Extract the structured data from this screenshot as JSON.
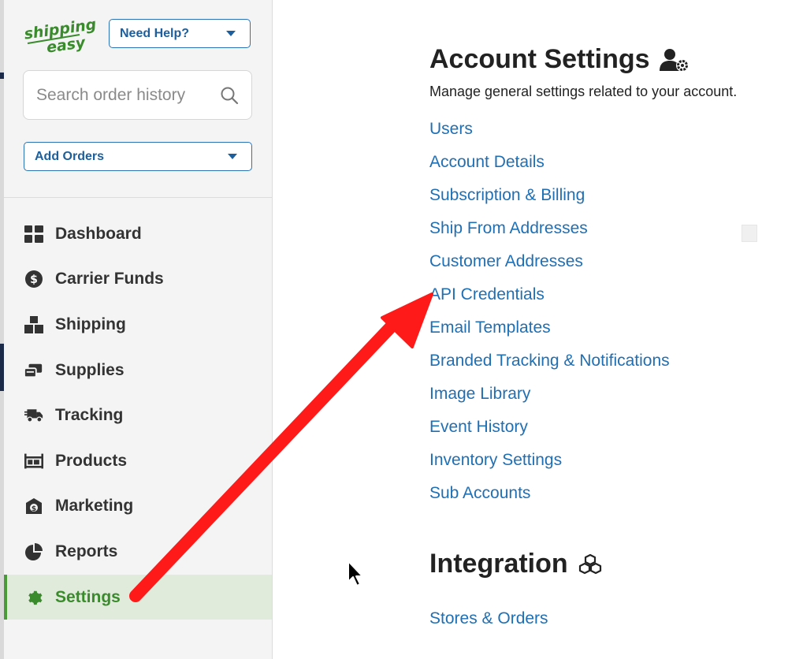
{
  "brand": {
    "logo_text_top": "shipping",
    "logo_text_bottom": "easy",
    "logo_color": "#3a8b2c"
  },
  "header": {
    "help_label": "Need Help?",
    "search_placeholder": "Search order history",
    "add_orders_label": "Add Orders"
  },
  "sidebar": {
    "items": [
      {
        "label": "Dashboard",
        "icon": "dashboard-icon"
      },
      {
        "label": "Carrier Funds",
        "icon": "dollar-icon"
      },
      {
        "label": "Shipping",
        "icon": "boxes-icon"
      },
      {
        "label": "Supplies",
        "icon": "supplies-icon"
      },
      {
        "label": "Tracking",
        "icon": "truck-icon"
      },
      {
        "label": "Products",
        "icon": "warehouse-icon"
      },
      {
        "label": "Marketing",
        "icon": "box-dollar-icon"
      },
      {
        "label": "Reports",
        "icon": "pie-chart-icon"
      },
      {
        "label": "Settings",
        "icon": "gear-icon",
        "active": true
      }
    ]
  },
  "main": {
    "account": {
      "title": "Account Settings",
      "subtitle": "Manage general settings related to your account.",
      "links": [
        "Users",
        "Account Details",
        "Subscription & Billing",
        "Ship From Addresses",
        "Customer Addresses",
        "API Credentials",
        "Email Templates",
        "Branded Tracking & Notifications",
        "Image Library",
        "Event History",
        "Inventory Settings",
        "Sub Accounts"
      ]
    },
    "integration": {
      "title": "Integration",
      "links": [
        "Stores & Orders"
      ]
    }
  },
  "colors": {
    "link": "#1f6fb5",
    "active_green": "#3a8b2c",
    "annotation_arrow": "#ff1a1a"
  }
}
